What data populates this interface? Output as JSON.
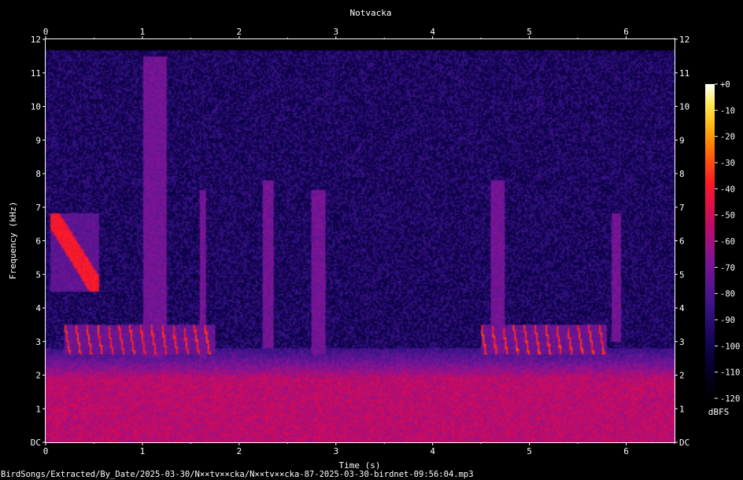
{
  "chart_data": {
    "type": "heatmap",
    "title": "Notvacka",
    "xlabel": "Time (s)",
    "ylabel": "Frequency (kHz)",
    "xlim": [
      0,
      6.5
    ],
    "ylim": [
      0,
      12
    ],
    "x_ticks": [
      "0",
      "1",
      "2",
      "3",
      "4",
      "5",
      "6"
    ],
    "y_ticks": [
      "DC",
      "1",
      "2",
      "3",
      "4",
      "5",
      "6",
      "7",
      "8",
      "9",
      "10",
      "11",
      "12"
    ],
    "colorbar": {
      "label": "dBFS",
      "ticks": [
        "+0",
        "-10",
        "-20",
        "-30",
        "-40",
        "-50",
        "-60",
        "-70",
        "-80",
        "-90",
        "-100",
        "-110",
        "-120"
      ],
      "range": [
        -120,
        0
      ]
    },
    "background_level_dbfs": -95,
    "low_band": {
      "from_khz": 0,
      "to_khz": 2.2,
      "dbfs": -55
    },
    "events": [
      {
        "t_start": 0.05,
        "t_end": 0.55,
        "f_low": 4.5,
        "f_high": 6.8,
        "kind": "descending-sweep"
      },
      {
        "t_start": 0.2,
        "t_end": 1.75,
        "f_low": 2.6,
        "f_high": 3.5,
        "kind": "note-series"
      },
      {
        "t_start": 1.0,
        "t_end": 1.25,
        "f_low": 2.5,
        "f_high": 11.5,
        "kind": "broadband-click"
      },
      {
        "t_start": 1.6,
        "t_end": 1.65,
        "f_low": 2.5,
        "f_high": 7.5,
        "kind": "broadband-click"
      },
      {
        "t_start": 2.25,
        "t_end": 2.35,
        "f_low": 2.8,
        "f_high": 7.8,
        "kind": "broadband-click"
      },
      {
        "t_start": 2.75,
        "t_end": 2.9,
        "f_low": 2.6,
        "f_high": 7.5,
        "kind": "broadband-click"
      },
      {
        "t_start": 4.5,
        "t_end": 5.8,
        "f_low": 2.6,
        "f_high": 3.5,
        "kind": "note-series"
      },
      {
        "t_start": 4.6,
        "t_end": 4.75,
        "f_low": 2.6,
        "f_high": 7.8,
        "kind": "broadband-click"
      },
      {
        "t_start": 5.85,
        "t_end": 5.95,
        "f_low": 3.0,
        "f_high": 6.8,
        "kind": "broadband-click"
      }
    ]
  },
  "footer": {
    "path": "BirdSongs/Extracted/By_Date/2025-03-30/N××tv××cka/N××tv××cka-87-2025-03-30-birdnet-09:56:04.mp3"
  }
}
